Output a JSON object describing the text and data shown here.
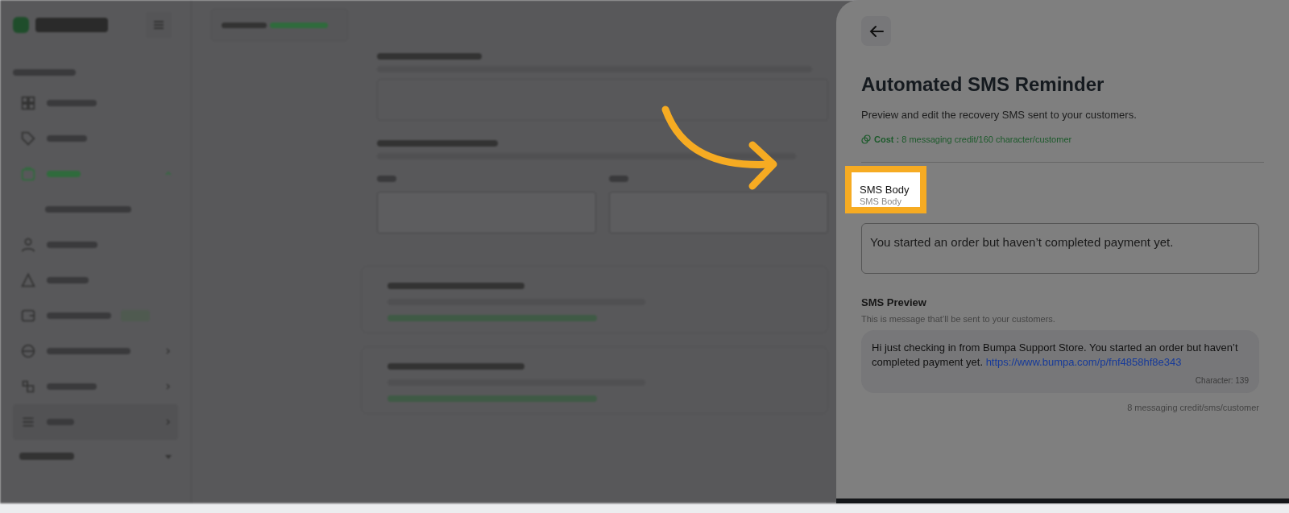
{
  "drawer": {
    "title": "Automated SMS Reminder",
    "subtitle": "Preview and edit the recovery SMS sent to your customers.",
    "cost_label": "Cost :",
    "cost_value": "8 messaging credit/160 character/customer",
    "body_label": "SMS Body",
    "body_hint": "SMS Body",
    "body_value": "You started an order but haven’t completed payment yet.",
    "preview_title": "SMS Preview",
    "preview_subtitle": "This is message that’ll be sent to your customers.",
    "preview_text": "Hi just checking in from Bumpa Support Store. You started an order but haven’t completed payment yet.",
    "preview_link": "https://www.bumpa.com/p/fnf4858hf8e343",
    "char_count": "Character: 139",
    "footnote": "8 messaging credit/sms/customer"
  }
}
